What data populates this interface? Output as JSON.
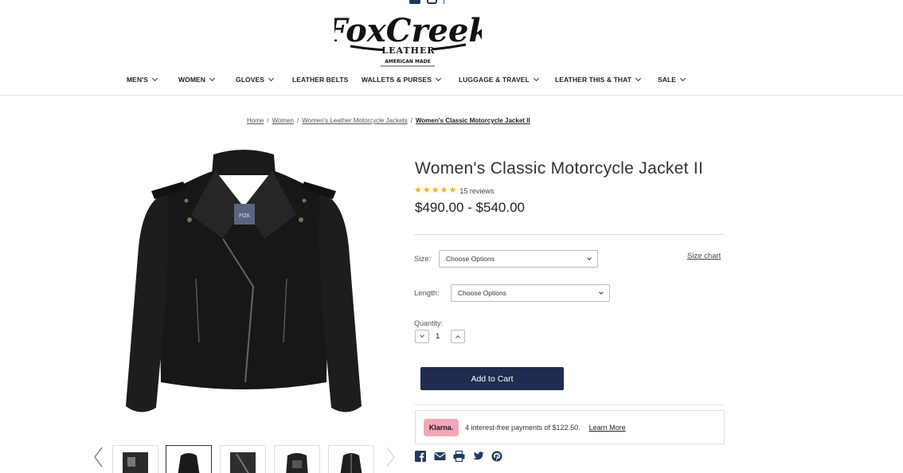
{
  "header": {
    "logo_text": "FoxCreek",
    "logo_sub": "LEATHER",
    "logo_tag": "AMERICAN MADE",
    "social_icons": [
      "facebook-icon",
      "instagram-icon"
    ]
  },
  "nav": {
    "items": [
      {
        "label": "MEN'S",
        "has_dropdown": true
      },
      {
        "label": "WOMEN",
        "has_dropdown": true
      },
      {
        "label": "GLOVES",
        "has_dropdown": true
      },
      {
        "label": "LEATHER BELTS",
        "has_dropdown": false
      },
      {
        "label": "WALLETS & PURSES",
        "has_dropdown": true
      },
      {
        "label": "LUGGAGE & TRAVEL",
        "has_dropdown": true
      },
      {
        "label": "LEATHER THIS & THAT",
        "has_dropdown": true
      },
      {
        "label": "SALE",
        "has_dropdown": true
      }
    ]
  },
  "breadcrumb": {
    "items": [
      "Home",
      "Women",
      "Women's Leather Motorcycle Jackets",
      "Women's Classic Motorcycle Jacket II"
    ],
    "separator": "/"
  },
  "product": {
    "title": "Women's Classic Motorcycle Jacket II",
    "rating_stars": 5,
    "reviews": "15 reviews",
    "price": "$490.00 - $540.00",
    "size_label": "Size:",
    "size_value": "Choose Options",
    "size_chart": "Size chart",
    "length_label": "Length:",
    "length_value": "Choose Options",
    "quantity_label": "Quantity:",
    "quantity_value": "1",
    "add_to_cart": "Add to Cart"
  },
  "klarna": {
    "badge": "Klarna.",
    "text": "4 interest-free payments of $122.50.",
    "link": "Learn More"
  },
  "share_icons": [
    "facebook-icon",
    "email-icon",
    "print-icon",
    "twitter-icon",
    "pinterest-icon"
  ],
  "gallery": {
    "thumbnail_count": 5,
    "active_index": 1
  },
  "colors": {
    "primary_button": "#1f2c4f",
    "star": "#f2b01e",
    "klarna_pink": "#f4a6b8",
    "social": "#23395d"
  }
}
